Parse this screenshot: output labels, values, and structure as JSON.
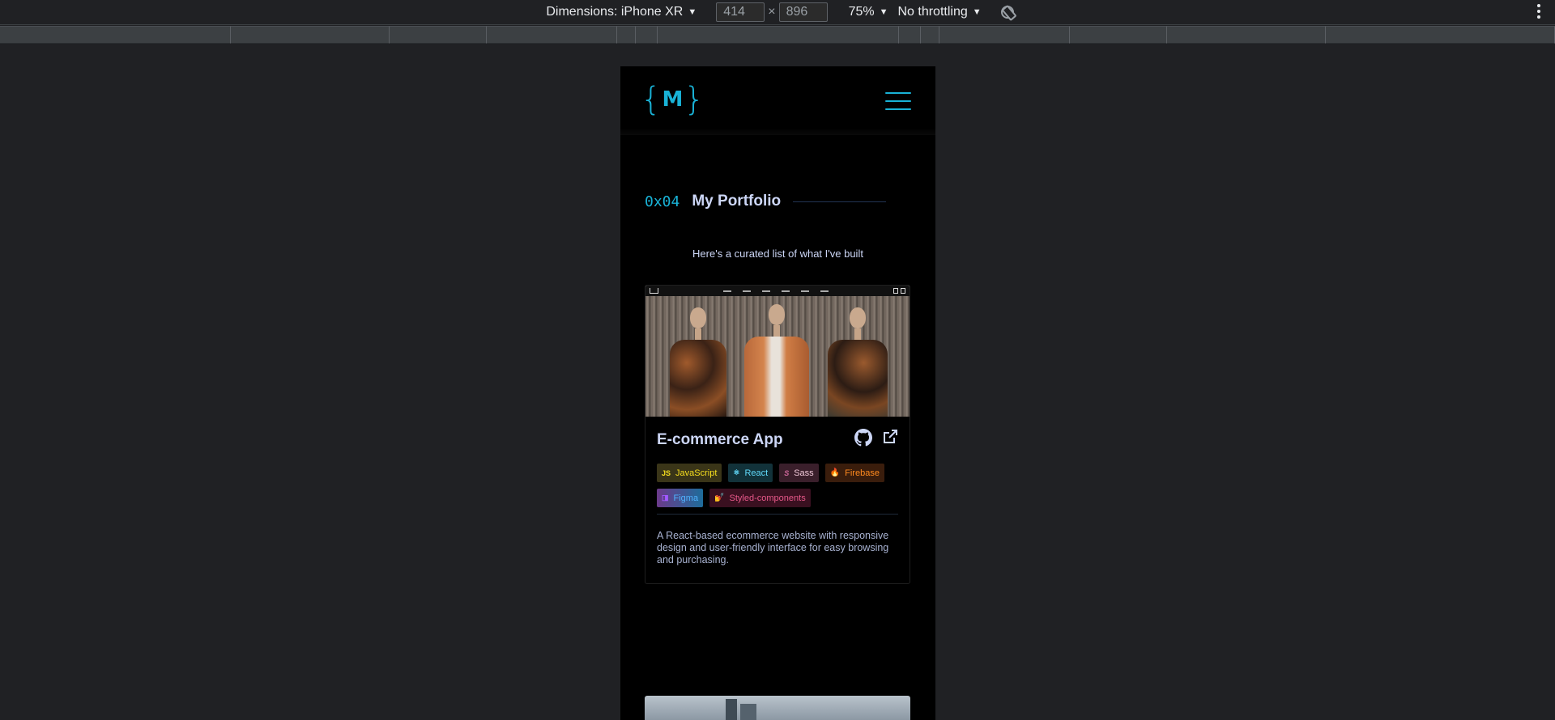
{
  "devtools": {
    "dimensions_label": "Dimensions: iPhone XR",
    "width": "414",
    "height": "896",
    "times": "×",
    "zoom": "75%",
    "throttling": "No throttling"
  },
  "page": {
    "logo": {
      "left": "{",
      "m": "M",
      "right": "}"
    },
    "section": {
      "number": "0x04",
      "title": "My Portfolio"
    },
    "subtitle": "Here's a curated list of what I've built",
    "projects": [
      {
        "title": "E-commerce App",
        "tags": [
          {
            "label": "JavaScript",
            "icon": "JS"
          },
          {
            "label": "React",
            "icon": "⚛"
          },
          {
            "label": "Sass",
            "icon": "S"
          },
          {
            "label": "Firebase",
            "icon": "🔥"
          },
          {
            "label": "Figma",
            "icon": "◨"
          },
          {
            "label": "Styled-components",
            "icon": "💅"
          }
        ],
        "description": "A React-based ecommerce website with responsive design and user-friendly interface for easy browsing and purchasing."
      }
    ]
  },
  "colors": {
    "accent": "#19b2d6",
    "background": "#000000",
    "devtools_bg": "#202124"
  }
}
